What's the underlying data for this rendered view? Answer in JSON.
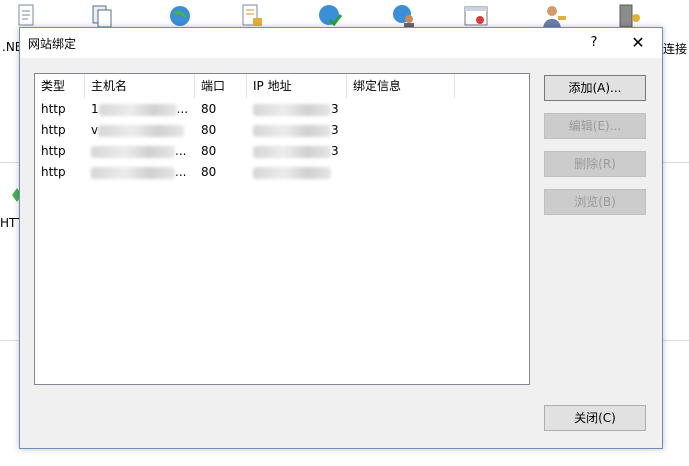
{
  "background": {
    "left_label": ".NE",
    "right_label": "连接",
    "side_label": "HTT"
  },
  "dialog": {
    "title": "网站绑定",
    "help_label": "?",
    "close_glyph": "✕"
  },
  "bindings": {
    "columns": [
      "类型",
      "主机名",
      "端口",
      "IP 地址",
      "绑定信息"
    ],
    "rows": [
      {
        "type": "http",
        "host_prefix": "1",
        "host_suffix": "...",
        "port": "80",
        "ip_suffix": "3",
        "info": ""
      },
      {
        "type": "http",
        "host_prefix": "v",
        "host_suffix": "",
        "port": "80",
        "ip_suffix": "3",
        "info": ""
      },
      {
        "type": "http",
        "host_prefix": "",
        "host_suffix": "...",
        "port": "80",
        "ip_suffix": "3",
        "info": ""
      },
      {
        "type": "http",
        "host_prefix": "",
        "host_suffix": "...",
        "port": "80",
        "ip_suffix": "",
        "info": ""
      }
    ]
  },
  "buttons": {
    "add": "添加(A)...",
    "edit": "编辑(E)...",
    "remove": "删除(R)",
    "browse": "浏览(B)",
    "close": "关闭(C)"
  }
}
